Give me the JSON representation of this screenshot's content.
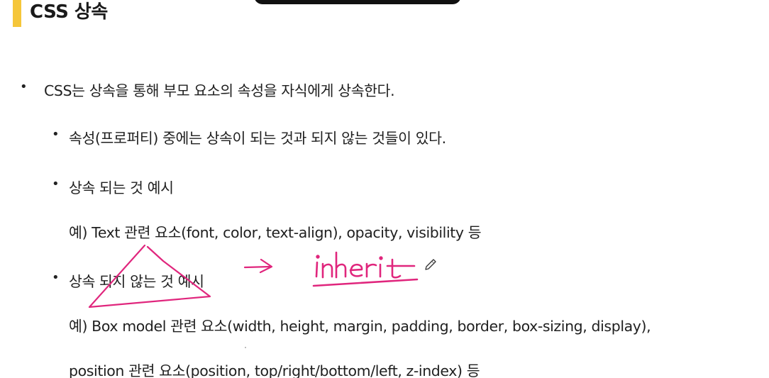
{
  "title": "CSS 상속",
  "content": {
    "l1": "CSS는 상속을 통해 부모 요소의 속성을 자식에게 상속한다.",
    "l2": "속성(프로퍼티) 중에는 상속이 되는 것과 되지 않는 것들이 있다.",
    "l3": "상속 되는 것 예시",
    "l4": "예) Text 관련 요소(font, color, text-align), opacity, visibility 등",
    "l5": "상속 되지 않는 것 예시",
    "l6": "예) Box model 관련 요소(width, height, margin, padding, border, box-sizing, display),",
    "l7": "position 관련 요소(position, top/right/bottom/left, z-index) 등"
  },
  "bullets": {
    "main": "•",
    "sub": "•"
  },
  "annotation": {
    "text": "inherit",
    "arrow": "→",
    "color": "#e0267d"
  },
  "colors": {
    "accent": "#f5c63a",
    "ink": "#e0267d",
    "text": "#1f1f1f"
  }
}
